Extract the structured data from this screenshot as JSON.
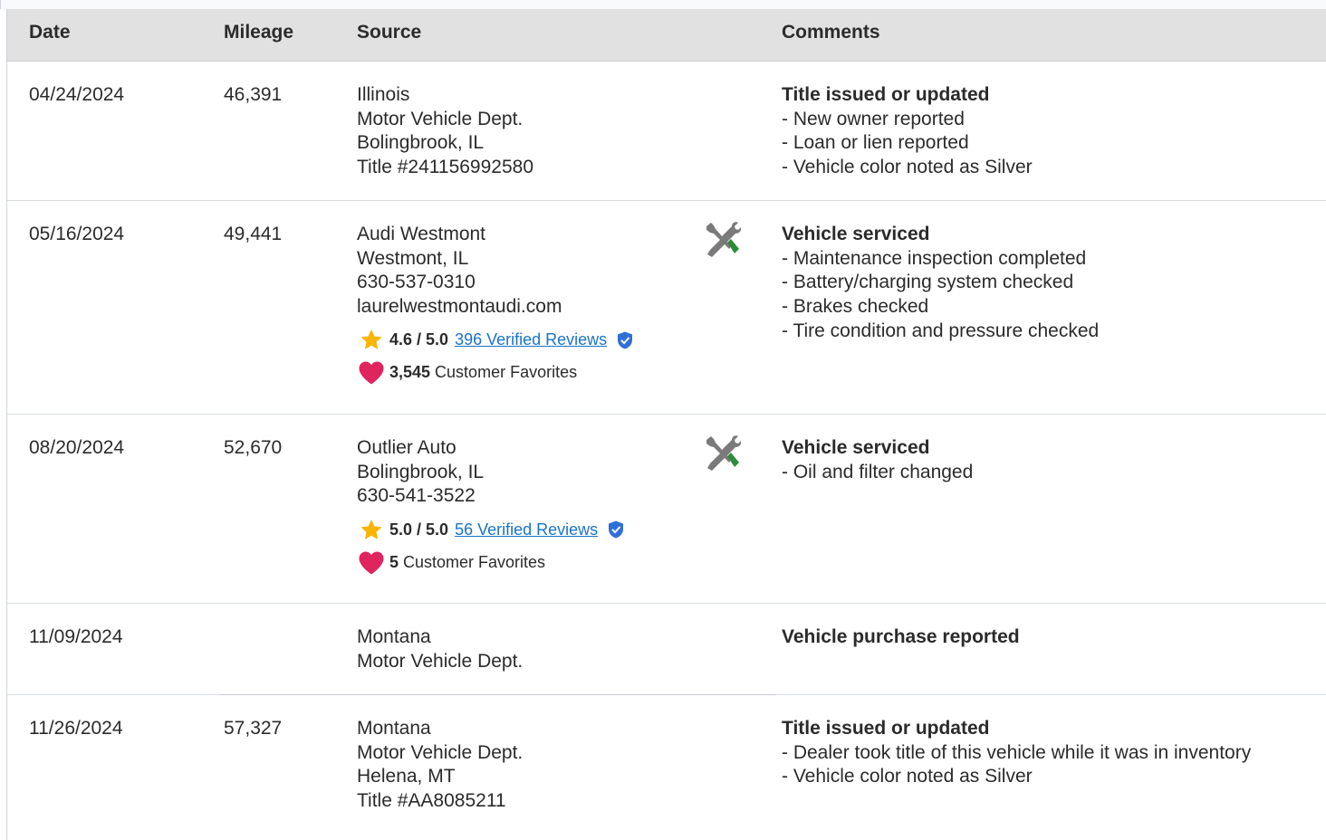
{
  "columns": {
    "date": "Date",
    "mileage": "Mileage",
    "source": "Source",
    "comments": "Comments"
  },
  "rows": [
    {
      "date": "04/24/2024",
      "mileage": "46,391",
      "source": [
        "Illinois",
        "Motor Vehicle Dept.",
        "Bolingbrook, IL",
        "Title #241156992580"
      ],
      "comment_title": "Title issued or updated",
      "comments": [
        "- New owner reported",
        "- Loan or lien reported",
        "- Vehicle color noted as Silver"
      ]
    },
    {
      "date": "05/16/2024",
      "mileage": "49,441",
      "source": [
        "Audi Westmont",
        "Westmont, IL",
        "630-537-0310",
        "laurelwestmontaudi.com"
      ],
      "rating": "4.6 / 5.0",
      "reviews_link": "396 Verified Reviews",
      "favorites_count": "3,545",
      "favorites_label": "Customer Favorites",
      "service_icon": "wrench-screwdriver-icon",
      "comment_title": "Vehicle serviced",
      "comments": [
        "- Maintenance inspection completed",
        "- Battery/charging system checked",
        "- Brakes checked",
        "- Tire condition and pressure checked"
      ]
    },
    {
      "date": "08/20/2024",
      "mileage": "52,670",
      "source": [
        "Outlier Auto",
        "Bolingbrook, IL",
        "630-541-3522"
      ],
      "rating": "5.0 / 5.0",
      "reviews_link": "56 Verified Reviews",
      "favorites_count": "5",
      "favorites_label": "Customer Favorites",
      "service_icon": "wrench-screwdriver-icon",
      "comment_title": "Vehicle serviced",
      "comments": [
        "- Oil and filter changed"
      ]
    },
    {
      "date": "11/09/2024",
      "mileage": "",
      "source": [
        "Montana",
        "Motor Vehicle Dept."
      ],
      "comment_title": "Vehicle purchase reported",
      "comments": []
    },
    {
      "date": "11/26/2024",
      "mileage": "57,327",
      "source": [
        "Montana",
        "Motor Vehicle Dept.",
        "Helena, MT",
        "Title #AA8085211"
      ],
      "comment_title": "Title issued or updated",
      "comments": [
        "- Dealer took title of this vehicle while it was in inventory",
        "- Vehicle color noted as Silver"
      ]
    }
  ],
  "colors": {
    "link": "#1a73c9",
    "star": "#f7b500",
    "heart": "#e0245e",
    "shield": "#2f6fd8",
    "wrench_gray": "#7a7a7a",
    "wrench_green": "#2e8b3a",
    "header_bg": "#e1e1e1"
  }
}
